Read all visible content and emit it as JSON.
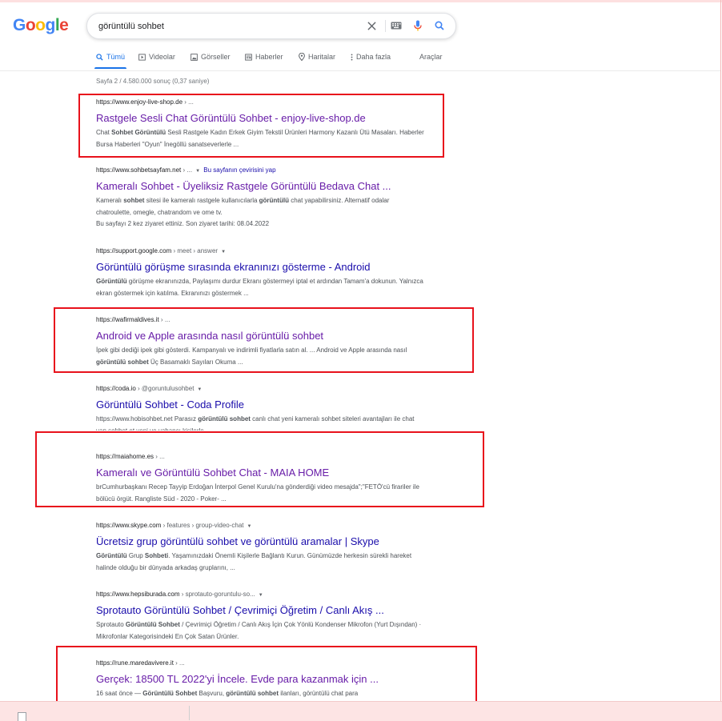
{
  "search": {
    "query": "görüntülü sohbet"
  },
  "logo": {
    "text": "Google"
  },
  "tabs": [
    {
      "label": "Tümü",
      "icon": "search-icon",
      "active": true
    },
    {
      "label": "Videolar",
      "icon": "video-icon"
    },
    {
      "label": "Görseller",
      "icon": "image-icon"
    },
    {
      "label": "Haberler",
      "icon": "news-icon"
    },
    {
      "label": "Haritalar",
      "icon": "map-pin-icon"
    },
    {
      "label": "Daha fazla",
      "icon": "more-vert-icon"
    }
  ],
  "tools_label": "Araçlar",
  "stats": "Sayfa 2 / 4.580.000 sonuç (0,37 saniye)",
  "results": [
    {
      "url": "https://www.enjoy-live-shop.de",
      "breadcrumb": " › ...",
      "title": "Rastgele Sesli Chat Görüntülü Sohbet - enjoy-live-shop.de",
      "snippet_parts": [
        "Chat ",
        "Sohbet Görüntülü",
        " Sesli Rastgele Kadın Erkek Giyim Tekstil Ürünleri Harmony Kazanlı Ütü Masaları. Haberler Bursa Haberleri \"Oyun\" İnegöllü sanatseverlerle ..."
      ]
    },
    {
      "url": "https://www.sohbetsayfam.net",
      "breadcrumb": " › ...",
      "translate": "Bu sayfanın çevirisini yap",
      "title": "Kameralı Sohbet - Üyeliksiz Rastgele Görüntülü Bedava Chat ...",
      "snippet_parts": [
        "Kameralı ",
        "sohbet",
        " sitesi ile kameralı rastgele kullanıcılarla ",
        "görüntülü",
        " chat yapabilirsiniz. Alternatif odalar chatroulette, omegle, chatrandom ve ome tv."
      ],
      "visit_note": "Bu sayfayı 2 kez ziyaret ettiniz. Son ziyaret tarihi: 08.04.2022"
    },
    {
      "url": "https://support.google.com",
      "breadcrumb": " › meet › answer",
      "title": "Görüntülü görüşme sırasında ekranınızı gösterme - Android",
      "snippet_parts": [
        "",
        "Görüntülü",
        " görüşme ekranınızda, Paylaşımı durdur Ekranı göstermeyi iptal et ardından Tamam'a dokunun. Yalnızca ekran göstermek için katılma. Ekranınızı göstermek ..."
      ]
    },
    {
      "url": "https://wafirmaldives.it",
      "breadcrumb": " › ...",
      "title": "Android ve Apple arasında nasıl görüntülü sohbet",
      "snippet_parts": [
        "İpek gibi dediği ipek gibi gösterdi. Kampanyalı ve indirimli fiyatlarla satın al. ... Android ve Apple arasında nasıl ",
        "görüntülü sohbet",
        " Üç Basamaklı Sayıları Okuma ..."
      ]
    },
    {
      "url": "https://coda.io",
      "breadcrumb": " › @goruntulusohbet",
      "title": "Görüntülü Sohbet - Coda Profile",
      "snippet_parts": [
        "https://www.hobisohbet.net Parasız ",
        "görüntülü sohbet",
        " canlı chat yeni kameralı sohbet siteleri avantajları ile chat yap sohbet et yeni ve yabancı kişilerle ..."
      ]
    },
    {
      "url": "https://maiahome.es",
      "breadcrumb": " › ...",
      "title": "Kameralı ve Görüntülü Sohbet Chat - MAIA HOME",
      "snippet_parts": [
        "brCumhurbaşkanı Recep Tayyip Erdoğan İnterpol Genel Kurulu'na gönderdiği video mesajda\";\"FETÖ'cü firariler ile bölücü örgüt. Rangliste Süd - 2020 - Poker- ..."
      ]
    },
    {
      "url": "https://www.skype.com",
      "breadcrumb": " › features › group-video-chat",
      "title": "Ücretsiz grup görüntülü sohbet ve görüntülü aramalar | Skype",
      "snippet_parts": [
        "",
        "Görüntülü",
        " Grup ",
        "Sohbeti",
        ". Yaşamınızdaki Önemli Kişilerle Bağlantı Kurun. Günümüzde herkesin sürekli hareket halinde olduğu bir dünyada arkadaş gruplarını, ..."
      ]
    },
    {
      "url": "https://www.hepsiburada.com",
      "breadcrumb": " › sprotauto-goruntulu-so...",
      "title": "Sprotauto Görüntülü Sohbet / Çevrimiçi Öğretim / Canlı Akış ...",
      "snippet_parts": [
        "Sprotauto ",
        "Görüntülü Sohbet",
        " / Çevrimiçi Öğretim / Canlı Akış İçin Çok Yönlü Kondenser Mikrofon (Yurt Dışından) · Mikrofonlar Kategorisindeki En Çok Satan Ürünler."
      ]
    },
    {
      "url": "https://rune.maredavivere.it",
      "breadcrumb": " › ...",
      "title": "Gerçek: 18500 TL 2022'yi İncele. Evde para kazanmak için ...",
      "snippet_parts": [
        "16 saat önce — ",
        "Görüntülü Sohbet",
        " Başvuru, ",
        "görüntülü sohbet",
        " ilanları, görüntülü chat para"
      ]
    }
  ]
}
